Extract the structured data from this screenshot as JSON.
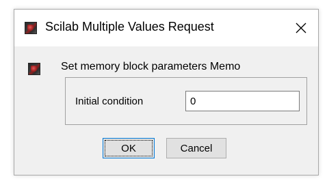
{
  "window": {
    "title": "Scilab Multiple Values Request",
    "app_icon": "scilab-icon",
    "close_icon": "close-icon"
  },
  "content": {
    "message_icon": "scilab-icon",
    "message": "Set memory block parameters Memo",
    "fields": [
      {
        "label": "Initial condition",
        "value": "0"
      }
    ]
  },
  "buttons": {
    "ok_label": "OK",
    "cancel_label": "Cancel"
  },
  "colors": {
    "dialog_bg": "#f0f0f0",
    "titlebar_bg": "#ffffff",
    "focus_border": "#0078d7"
  }
}
